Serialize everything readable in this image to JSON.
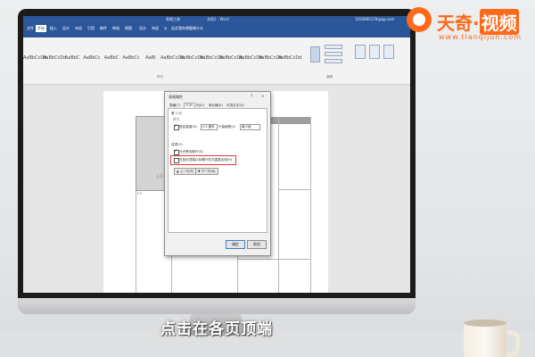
{
  "word": {
    "context_title": "表格工具",
    "file_title": "文档1 - Word",
    "account": "1050860178@qq.com",
    "tabs": [
      "文件",
      "开始",
      "插入",
      "设计",
      "布局",
      "引用",
      "邮件",
      "审阅",
      "视图",
      "设计",
      "布局",
      "♀",
      "告诉我你想要做什么"
    ],
    "active_tab_index": 1,
    "style_previews": [
      "AaBbCcDd",
      "AaBbCcDd",
      "AaBbC",
      "AaBbCc",
      "AaBbC",
      "AaBbCc",
      "AaBl",
      "AaBbCcDd",
      "AaBbCcDd",
      "AaBbCcDd",
      "AaBbCcDd",
      "AaBbCcDd",
      "AaBbCcDd",
      "AaBbCcDd"
    ],
    "group_label_styles": "样式",
    "group_label_edit": "编辑",
    "doc_caption_1": "上下",
    "doc_caption_2": "L+"
  },
  "dialog": {
    "title": "表格属性",
    "help": "?",
    "close": "×",
    "tabs": [
      "表格(T)",
      "行(R)",
      "列(U)",
      "单元格(E)",
      "可选文字(A)"
    ],
    "active_tab_index": 1,
    "section_size": "第 1 行:",
    "size_label": "尺寸",
    "height_checkbox": "指定高度(S):",
    "height_value": "0.5 厘米",
    "row_height_label": "行高值是(I):",
    "row_height_value": "最小值",
    "section_options": "选项(O)",
    "allow_break": "允许跨页断行(K)",
    "repeat_header": "在各页顶端以标题行形式重复出现(H)",
    "prev_row": "▲ 上一行(P)",
    "next_row": "▼ 下一行(N)",
    "ok": "确定",
    "cancel": "取消"
  },
  "subtitle": "点击在各页顶端",
  "logo": {
    "text_a": "天奇·",
    "text_b": "视频",
    "url": "www.tianqijun.com"
  },
  "colors": {
    "word_blue": "#2b579a",
    "brand_orange": "#ff6a1a",
    "highlight_red": "#e13a3a"
  }
}
